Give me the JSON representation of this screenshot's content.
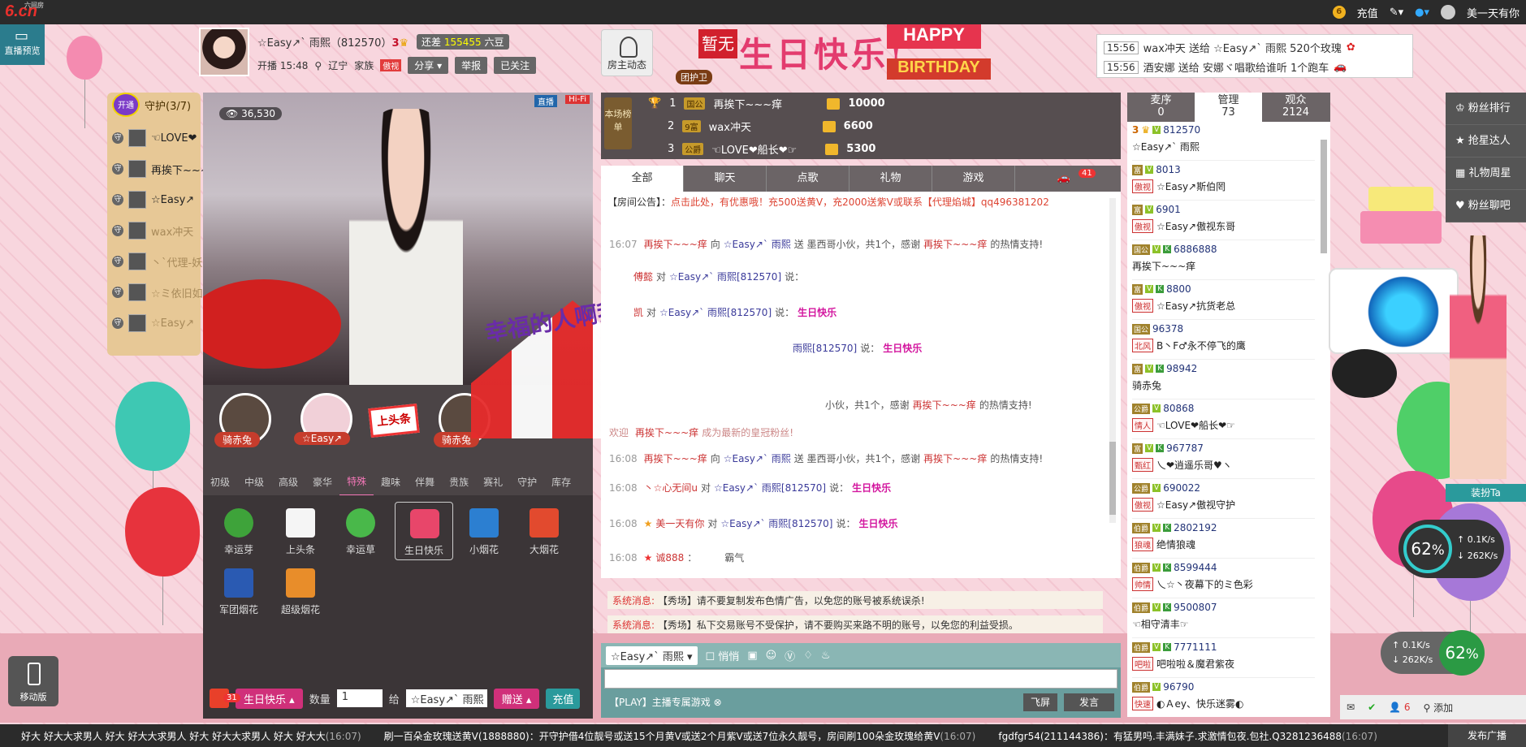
{
  "topbar": {
    "logo": "6.cn",
    "logo_small": "六间房",
    "coin_label": "6",
    "recharge": "充值",
    "username": "美一天有你"
  },
  "left_buttons": {
    "preview": "直播预览",
    "mobile": "移动版"
  },
  "host": {
    "name": "☆Easy↗` 雨熙",
    "room_id": "（812570）",
    "level": "3",
    "beans_label": "还差",
    "beans_value": "155455",
    "beans_unit": "六豆",
    "start_time": "开播 15:48",
    "location": "辽宁",
    "family_label": "家族",
    "family_tag": "傲视",
    "share": "分享",
    "report": "举报",
    "followed": "已关注"
  },
  "feed_button": "房主动态",
  "guardian_tag": "团护卫",
  "banner": {
    "prefix": "暂无",
    "main": "生日快乐!",
    "happy": "HAPPY",
    "birthday": "BIRTHDAY"
  },
  "gift_notice": [
    {
      "time": "15:56",
      "text": "wax冲天 送给 ☆Easy↗` 雨熙 520个玫瑰"
    },
    {
      "time": "15:56",
      "text": "酒安娜 送给 安娜ヾ唱歌给谁听 1个跑车"
    }
  ],
  "guard_panel": {
    "open_badge": "开通",
    "title": "守护(3/7)",
    "members": [
      "☜LOVE❤",
      "再挨下~~~",
      "☆Easy↗",
      "wax冲天",
      "丶`代理-妖",
      "☆ミ依旧如",
      "☆Easy↗"
    ]
  },
  "video": {
    "audience": "36,530",
    "live": "直播",
    "hifi": "Hi-Fi",
    "overlay_text": "幸福的人啊我"
  },
  "anchors": [
    {
      "label": "骑赤兔"
    },
    {
      "label": "☆Easy↗"
    },
    {
      "label": "骑赤兔"
    },
    {
      "label": "上头条"
    }
  ],
  "gift_tabs": [
    "初级",
    "中级",
    "高级",
    "豪华",
    "特殊",
    "趣味",
    "伴舞",
    "贵族",
    "赛礼",
    "守护",
    "库存"
  ],
  "gift_tab_active": 4,
  "gifts": [
    {
      "name": "幸运芽",
      "color": "#3ea33a"
    },
    {
      "name": "上头条",
      "color": "#f5f5f5"
    },
    {
      "name": "幸运草",
      "color": "#49b84a"
    },
    {
      "name": "生日快乐",
      "color": "#e8466a"
    },
    {
      "name": "小烟花",
      "color": "#2c7fd1"
    },
    {
      "name": "大烟花",
      "color": "#e24a2e"
    },
    {
      "name": "军团烟花",
      "color": "#2a5ab2"
    },
    {
      "name": "超级烟花",
      "color": "#e88d2a"
    }
  ],
  "send_bar": {
    "count": "31",
    "selected_gift": "生日快乐",
    "qty_label": "数量",
    "qty": "1",
    "to_label": "给",
    "to": "☆Easy↗` 雨熙",
    "send": "赠送",
    "recharge": "充值"
  },
  "rank": {
    "label": "本场榜单",
    "rows": [
      {
        "no": "1",
        "level": "国公",
        "name": "再挨下~~~痒",
        "value": "10000"
      },
      {
        "no": "2",
        "level": "9富",
        "name": "wax冲天",
        "value": "6600"
      },
      {
        "no": "3",
        "level": "公爵",
        "name": "☜LOVE❤船长❤☞",
        "value": "5300"
      }
    ]
  },
  "chat_tabs": [
    "全部",
    "聊天",
    "点歌",
    "礼物",
    "游戏",
    ""
  ],
  "chat_tab_badge": "41",
  "announce": {
    "label": "【房间公告】：",
    "text": "点击此处，有优惠哦！充500送黄V，充2000送紫V或联系【代理焰城】qq496381202"
  },
  "messages": [
    {
      "time": "16:07",
      "from": "再挨下~~~痒",
      "mid": " 向 ",
      "to": "☆Easy↗` 雨熙",
      "text": " 送 墨西哥小伙，共1个，感谢 ",
      "thanks": "再挨下~~~痒",
      "tail": " 的热情支持!"
    },
    {
      "time": "",
      "from": "傅懿",
      "mid": " 对 ",
      "to": "☆Easy↗` 雨熙[812570]",
      "text": " 说：",
      "thanks": "",
      "tail": ""
    },
    {
      "time": "",
      "from": "凯",
      "mid": " 对 ",
      "to": "☆Easy↗` 雨熙[812570]",
      "text": " 说：",
      "thanks": "生日快乐",
      "tail": ""
    },
    {
      "time": "",
      "from": "",
      "mid": "",
      "to": "雨熙[812570]",
      "text": " 说：",
      "thanks": "生日快乐",
      "tail": ""
    },
    {
      "time": "",
      "from": "",
      "mid": "",
      "to": "",
      "text": "小伙，共1个，感谢 ",
      "thanks": "再挨下~~~痒",
      "tail": " 的热情支持!"
    },
    {
      "time": "",
      "from": "欢迎",
      "mid": " ",
      "to": "再挨下~~~痒",
      "text": " 成为最新的皇冠粉丝!",
      "thanks": "",
      "tail": ""
    },
    {
      "time": "16:08",
      "from": "再挨下~~~痒",
      "mid": " 向 ",
      "to": "☆Easy↗` 雨熙",
      "text": " 送 墨西哥小伙，共1个，感谢 ",
      "thanks": "再挨下~~~痒",
      "tail": " 的热情支持!"
    },
    {
      "time": "16:08",
      "from": "丶☆心无间u",
      "mid": " 对 ",
      "to": "☆Easy↗` 雨熙[812570]",
      "text": " 说：",
      "thanks": "生日快乐",
      "tail": ""
    },
    {
      "time": "16:08",
      "from": "美一天有你",
      "mid": " 对 ",
      "to": "☆Easy↗` 雨熙[812570]",
      "text": " 说：",
      "thanks": "生日快乐",
      "tail": ""
    },
    {
      "time": "16:08",
      "from": "诚888",
      "mid": "",
      "to": "",
      "text": "：",
      "thanks": "霸气",
      "tail": ""
    }
  ],
  "system": [
    {
      "label": "系统消息:",
      "text": "【秀场】请不要复制发布色情广告，以免您的账号被系统误杀!"
    },
    {
      "label": "系统消息:",
      "text": "【秀场】私下交易账号不受保护，请不要购买来路不明的账号，以免您的利益受损。"
    }
  ],
  "input": {
    "target": "☆Easy↗` 雨熙",
    "quiet": "悄悄",
    "play": "【PLAY】主播专属游戏",
    "fly": "飞屏",
    "send": "发言"
  },
  "user_tabs": [
    {
      "label": "麦序",
      "count": "0"
    },
    {
      "label": "管理",
      "count": "73"
    },
    {
      "label": "观众",
      "count": "2124"
    }
  ],
  "users": [
    {
      "id": "812570",
      "tag": "",
      "name": "☆Easy↗` 雨熙",
      "level": "3"
    },
    {
      "id": "8013",
      "tag": "傲视",
      "name": "☆Easy↗斯伯罔",
      "level": "富"
    },
    {
      "id": "6901",
      "tag": "傲视",
      "name": "☆Easy↗傲视东哥",
      "level": "富"
    },
    {
      "id": "6886888",
      "tag": "",
      "name": "再挨下~~~痒",
      "level": "国公"
    },
    {
      "id": "8800",
      "tag": "傲视",
      "name": "☆Easy↗抗货老总",
      "level": "富"
    },
    {
      "id": "96378",
      "tag": "北风",
      "name": "B丶F♂永不停飞的鹰",
      "level": "国公"
    },
    {
      "id": "98942",
      "tag": "",
      "name": "骑赤兔",
      "level": "富"
    },
    {
      "id": "80868",
      "tag": "情人",
      "name": "☜LOVE❤船长❤☞",
      "level": "公爵"
    },
    {
      "id": "967787",
      "tag": "甄红",
      "name": "乀❤逍遥乐哥♥ヽ",
      "level": "富"
    },
    {
      "id": "690022",
      "tag": "傲视",
      "name": "☆Easy↗傲视守护",
      "level": "公爵"
    },
    {
      "id": "2802192",
      "tag": "狼魂",
      "name": "绝情狼魂",
      "level": "伯爵"
    },
    {
      "id": "8599444",
      "tag": "帅情",
      "name": "乀☆丶夜幕下的ミ色彩",
      "level": "伯爵"
    },
    {
      "id": "9500807",
      "tag": "",
      "name": "☜相守清丰☞",
      "level": "伯爵"
    },
    {
      "id": "7771111",
      "tag": "吧啦",
      "name": "吧啦啦＆魔君紫夜",
      "level": "伯爵"
    },
    {
      "id": "96790",
      "tag": "快速",
      "name": "◐Ａey、快乐迷雾◐",
      "level": "伯爵"
    }
  ],
  "side_menu": [
    "粉丝排行",
    "抢星达人",
    "礼物周星",
    "粉丝聊吧"
  ],
  "dressup": "装扮Ta",
  "speed": {
    "percent": "62",
    "unit": "%",
    "up": "0.1K/s",
    "down": "262K/s"
  },
  "bottom_right": {
    "count": "6",
    "add": "添加"
  },
  "ticker": [
    {
      "text": "好大 好大大求男人 好大 好大大求男人 好大 好大大求男人 好大 好大大",
      "time": "(16:07)"
    },
    {
      "text": "刷一百朵金玫瑰送黄V(1888880)：开守护借4位靓号或送15个月黄V或送2个月紫V或送7位永久靓号，房间刷100朵金玫瑰给黄V",
      "time": "(16:07)"
    },
    {
      "text": "fgdfgr54(211144386)：有猛男吗.丰满妹子.求激情包夜.包社.Q3281236488",
      "time": "(16:07)"
    }
  ],
  "publish": "发布广播",
  "colors": {
    "accent": "#d0307a",
    "teal": "#2a9a9c",
    "bg": "#f6cfd8"
  }
}
